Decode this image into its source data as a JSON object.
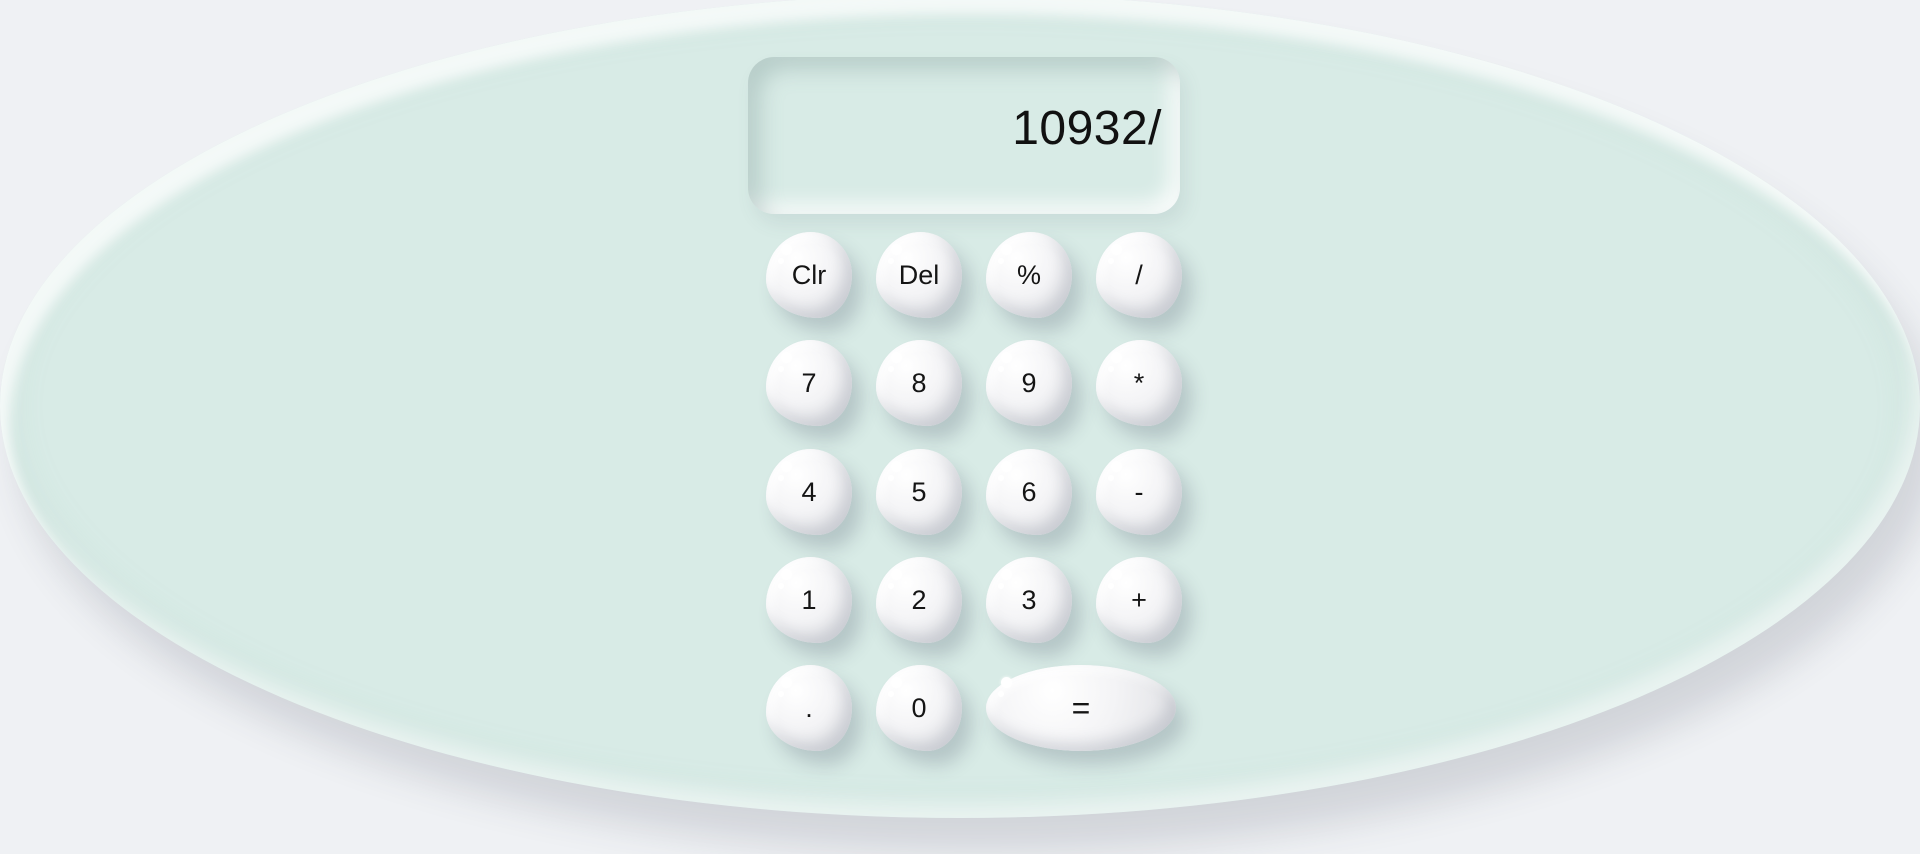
{
  "calculator": {
    "display_value": "10932/",
    "keys": [
      {
        "name": "clear-button",
        "label": "Clr"
      },
      {
        "name": "delete-button",
        "label": "Del"
      },
      {
        "name": "percent-button",
        "label": "%"
      },
      {
        "name": "divide-button",
        "label": "/"
      },
      {
        "name": "digit-7-button",
        "label": "7"
      },
      {
        "name": "digit-8-button",
        "label": "8"
      },
      {
        "name": "digit-9-button",
        "label": "9"
      },
      {
        "name": "multiply-button",
        "label": "*"
      },
      {
        "name": "digit-4-button",
        "label": "4"
      },
      {
        "name": "digit-5-button",
        "label": "5"
      },
      {
        "name": "digit-6-button",
        "label": "6"
      },
      {
        "name": "subtract-button",
        "label": "-"
      },
      {
        "name": "digit-1-button",
        "label": "1"
      },
      {
        "name": "digit-2-button",
        "label": "2"
      },
      {
        "name": "digit-3-button",
        "label": "3"
      },
      {
        "name": "add-button",
        "label": "+"
      },
      {
        "name": "decimal-point-button",
        "label": "."
      },
      {
        "name": "digit-0-button",
        "label": "0"
      },
      {
        "name": "equals-button",
        "label": "="
      }
    ]
  },
  "colors": {
    "background": "#eff1f4",
    "body": "#d8ebe6",
    "key": "#f4f4f6",
    "text": "#111111"
  }
}
